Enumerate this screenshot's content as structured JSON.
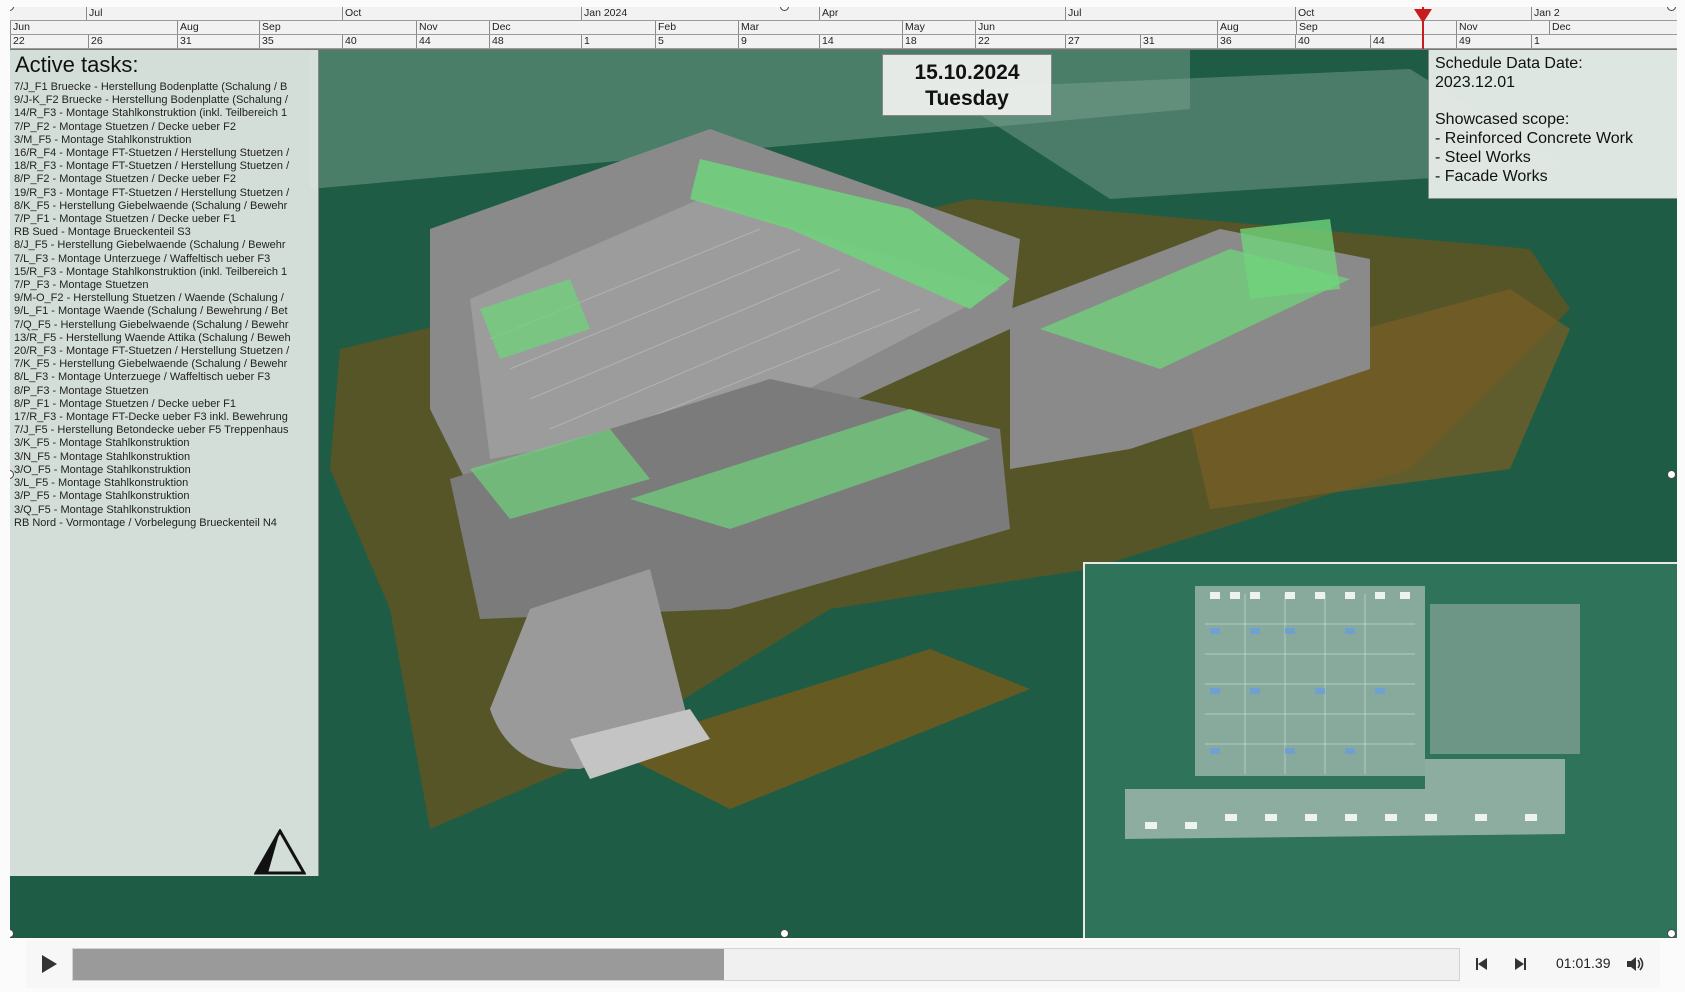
{
  "timeline": {
    "years": [
      {
        "label": "",
        "span": 2
      },
      {
        "label": "Jan 2024",
        "span": 0
      },
      {
        "label": "Jan 2",
        "span": 0
      }
    ],
    "months": [
      "Jun",
      "Jul",
      "Aug",
      "Sep",
      "Oct",
      "Nov",
      "Dec",
      "Jan 2024",
      "Feb",
      "Mar",
      "Apr",
      "May",
      "Jun",
      "Jul",
      "Aug",
      "Sep",
      "Oct",
      "Nov",
      "Dec",
      "Jan 2"
    ],
    "months_row2": [
      "Jun",
      "Aug",
      "Sep",
      "Nov",
      "Dec",
      "Feb",
      "Mar",
      "May",
      "Jun",
      "Aug",
      "Sep",
      "Nov",
      "Dec"
    ],
    "weeks": [
      "22",
      "26",
      "31",
      "35",
      "40",
      "44",
      "48",
      "1",
      "5",
      "9",
      "14",
      "18",
      "22",
      "27",
      "31",
      "36",
      "40",
      "44",
      "49",
      "1"
    ],
    "top_months": [
      "Jul",
      "Oct",
      "Jan 2024",
      "Apr",
      "Jul",
      "Oct",
      "Jan 2"
    ],
    "marker_color": "#c91d1d"
  },
  "tasks": {
    "title": "Active tasks:",
    "items": [
      "7/J_F1 Bruecke - Herstellung Bodenplatte (Schalung / B",
      "9/J-K_F2 Bruecke - Herstellung Bodenplatte (Schalung /",
      "14/R_F3 - Montage Stahlkonstruktion (inkl. Teilbereich 1",
      "7/P_F2 - Montage Stuetzen / Decke ueber F2",
      "3/M_F5 - Montage Stahlkonstruktion",
      "16/R_F4 - Montage FT-Stuetzen / Herstellung Stuetzen /",
      "18/R_F3 - Montage FT-Stuetzen / Herstellung Stuetzen /",
      "8/P_F2 - Montage Stuetzen / Decke ueber F2",
      "19/R_F3 - Montage FT-Stuetzen / Herstellung Stuetzen /",
      "8/K_F5 - Herstellung Giebelwaende (Schalung / Bewehr",
      "7/P_F1 - Montage Stuetzen / Decke ueber F1",
      "RB Sued - Montage Brueckenteil S3",
      "8/J_F5 - Herstellung Giebelwaende (Schalung / Bewehr",
      "7/L_F3 - Montage Unterzuege / Waffeltisch ueber F3",
      "15/R_F3 - Montage Stahlkonstruktion (inkl. Teilbereich 1",
      "7/P_F3 - Montage Stuetzen",
      "9/M-O_F2 - Herstellung Stuetzen / Waende (Schalung /",
      "9/L_F1 - Montage Waende (Schalung / Bewehrung / Bet",
      "7/Q_F5 - Herstellung Giebelwaende (Schalung / Bewehr",
      "13/R_F5 - Herstellung Waende Attika (Schalung / Beweh",
      "20/R_F3 - Montage FT-Stuetzen / Herstellung Stuetzen /",
      "7/K_F5 - Herstellung Giebelwaende (Schalung / Bewehr",
      "8/L_F3 - Montage Unterzuege / Waffeltisch ueber F3",
      "8/P_F3 - Montage Stuetzen",
      "8/P_F1 - Montage Stuetzen / Decke ueber F1",
      "17/R_F3 - Montage FT-Decke ueber F3 inkl. Bewehrung",
      "7/J_F5 - Herstellung Betondecke ueber F5 Treppenhaus",
      "3/K_F5 - Montage Stahlkonstruktion",
      "3/N_F5 - Montage Stahlkonstruktion",
      "3/O_F5 - Montage Stahlkonstruktion",
      "3/L_F5 - Montage Stahlkonstruktion",
      "3/P_F5 - Montage Stahlkonstruktion",
      "3/Q_F5 - Montage Stahlkonstruktion",
      "RB Nord - Vormontage / Vorbelegung Brueckenteil N4"
    ]
  },
  "date_box": {
    "date": "15.10.2024",
    "day": "Tuesday"
  },
  "info_box": {
    "data_date_label": "Schedule Data Date:",
    "data_date_value": "2023.12.01",
    "scope_label": "Showcased scope:",
    "scope_items": [
      "- Reinforced Concrete Work",
      "- Steel Works",
      "- Facade Works"
    ]
  },
  "player": {
    "progress": 0.47,
    "time": "01:01.39",
    "play_icon": "play-icon",
    "prev_icon": "step-back-icon",
    "next_icon": "step-forward-icon",
    "volume_icon": "volume-icon"
  },
  "colors": {
    "ground": "#1d5a44",
    "highlight": "#6fd37a",
    "concrete": "#8b8b8b",
    "earth": "#6b5a1e",
    "marker": "#c91d1d"
  }
}
